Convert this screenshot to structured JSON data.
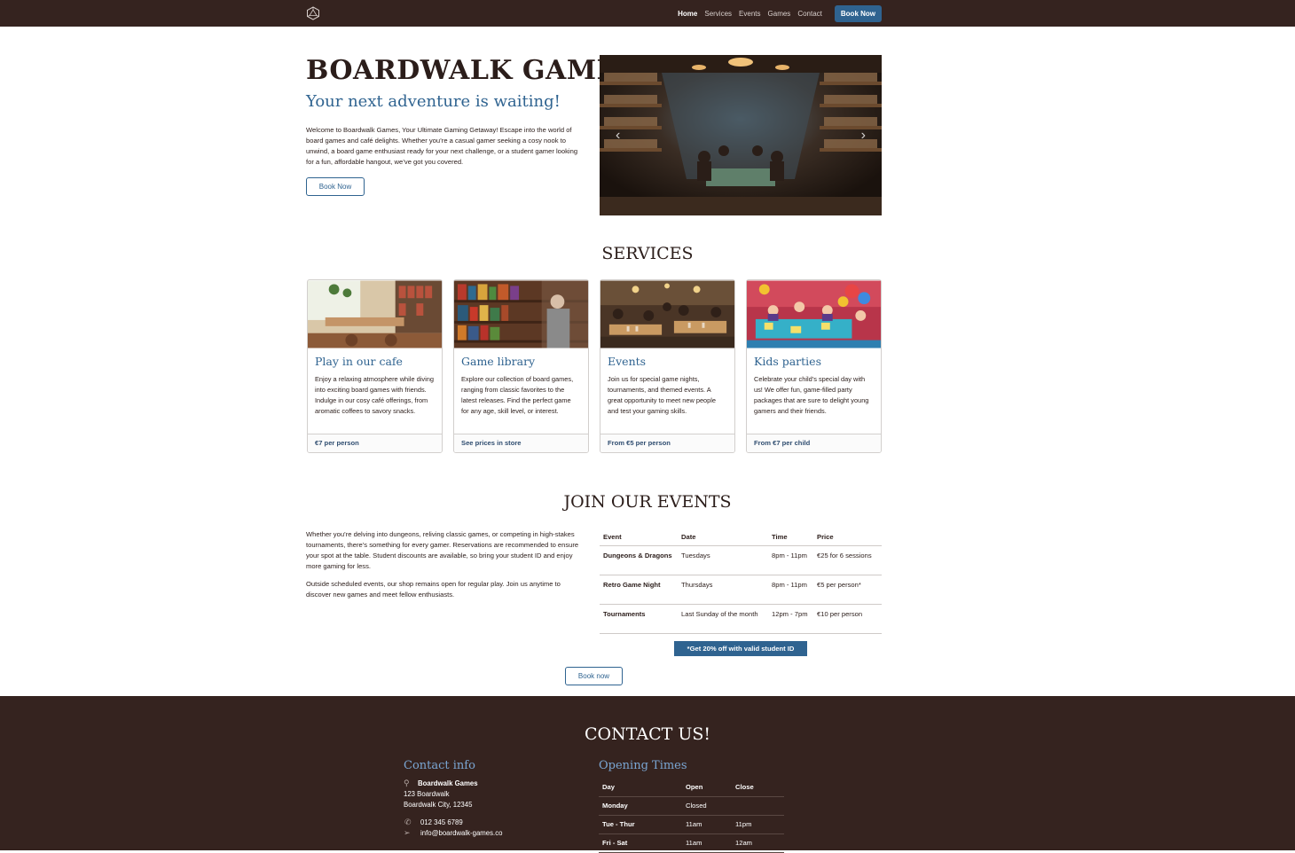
{
  "nav": {
    "logo_icon": "d20-icon",
    "links": [
      "Home",
      "Services",
      "Events",
      "Games",
      "Contact"
    ],
    "cta": "Book Now"
  },
  "hero": {
    "title": "BOARDWALK GAMES",
    "subtitle": "Your next adventure is waiting!",
    "text": "Welcome to Boardwalk Games, Your Ultimate Gaming Getaway! Escape into the world of board games and café delights. Whether you’re a casual gamer seeking a cosy nook to unwind, a board game enthusiast ready for your next challenge, or a student gamer looking for a fun, affordable hangout, we’ve got you covered.",
    "button": "Book Now",
    "carousel_prev": "‹",
    "carousel_next": "›"
  },
  "services": {
    "title": "SERVICES",
    "cards": [
      {
        "title": "Play in our cafe",
        "text": "Enjoy a relaxing atmosphere while diving into exciting board games with friends. Indulge in our cosy café offerings, from aromatic coffees to savory snacks.",
        "footer": "€7 per person"
      },
      {
        "title": "Game library",
        "text": "Explore our collection of board games, ranging from classic favorites to the latest releases. Find the perfect game for any age, skill level, or interest.",
        "footer": "See prices in store"
      },
      {
        "title": "Events",
        "text": "Join us for special game nights, tournaments, and themed events. A great opportunity to meet new people and test your gaming skills.",
        "footer": "From €5 per person"
      },
      {
        "title": "Kids parties",
        "text": "Celebrate your child’s special day with us! We offer fun, game-filled party packages that are sure to delight young gamers and their friends.",
        "footer": "From €7 per child"
      }
    ]
  },
  "events": {
    "title": "JOIN OUR EVENTS",
    "para1": "Whether you’re delving into dungeons, reliving classic games, or competing in high-stakes tournaments, there’s something for every gamer. Reservations are recommended to ensure your spot at the table. Student discounts are available, so bring your student ID and enjoy more gaming for less.",
    "para2": "Outside scheduled events, our shop remains open for regular play. Join us anytime to discover new games and meet fellow enthusiasts.",
    "headers": [
      "Event",
      "Date",
      "Time",
      "Price"
    ],
    "rows": [
      [
        "Dungeons & Dragons",
        "Tuesdays",
        "8pm - 11pm",
        "€25 for 6 sessions"
      ],
      [
        "Retro Game Night",
        "Thursdays",
        "8pm - 11pm",
        "€5 per person*"
      ],
      [
        "Tournaments",
        "Last Sunday of the month",
        "12pm - 7pm",
        "€10 per person"
      ]
    ],
    "discount": "*Get 20% off with valid student ID",
    "button": "Book now"
  },
  "contact": {
    "title": "CONTACT US!",
    "info_heading": "Contact info",
    "name": "Boardwalk Games",
    "address1": "123 Boardwalk",
    "address2": "Boardwalk City, 12345",
    "phone": "012 345 6789",
    "email": "info@boardwalk-games.co",
    "hours_heading": "Opening Times",
    "hours_headers": [
      "Day",
      "Open",
      "Close"
    ],
    "hours": [
      [
        "Monday",
        "Closed",
        ""
      ],
      [
        "Tue - Thur",
        "11am",
        "11pm"
      ],
      [
        "Fri - Sat",
        "11am",
        "12am"
      ]
    ]
  },
  "colors": {
    "brand_dark": "#35231f",
    "accent_blue": "#2f6390"
  }
}
